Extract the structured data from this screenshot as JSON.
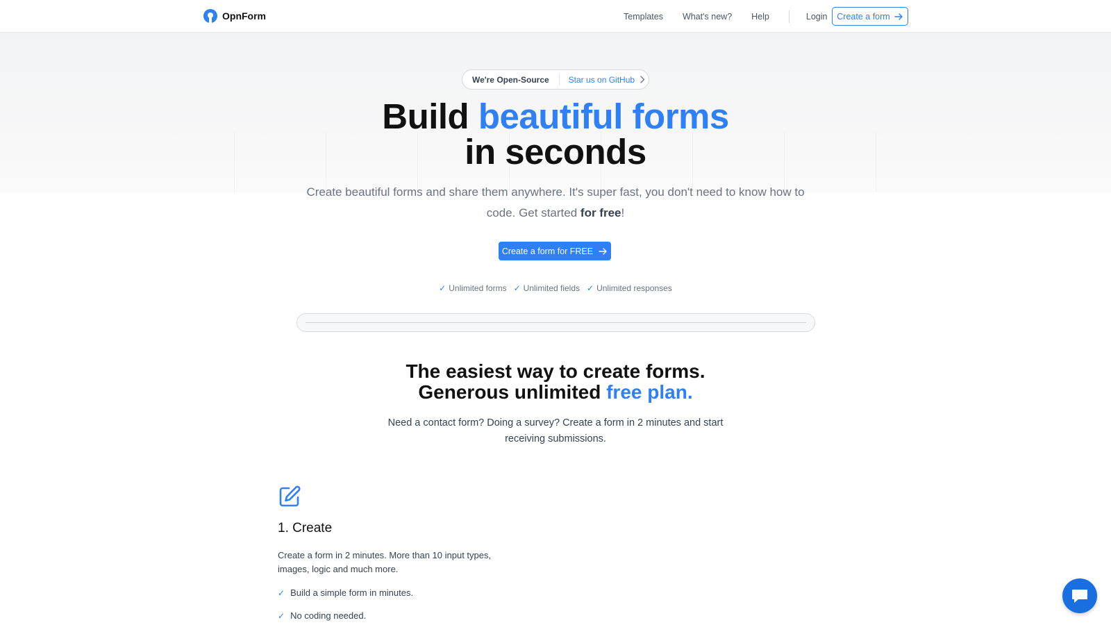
{
  "nav": {
    "brand": "OpnForm",
    "links": [
      "Templates",
      "What's new?",
      "Help"
    ],
    "login": "Login",
    "cta": "Create a form"
  },
  "hero": {
    "pill_left": "We're Open-Source",
    "pill_right": "Star us on GitHub",
    "title_part1": "Build ",
    "title_highlight": "beautiful forms",
    "title_line2": "in seconds",
    "subtitle_part1": "Create beautiful forms and share them anywhere. It's super fast, you don't need to know how to code. Get started ",
    "subtitle_bold": "for free",
    "subtitle_end": "!",
    "cta": "Create a form for FREE",
    "checks": [
      "Unlimited forms",
      "Unlimited fields",
      "Unlimited responses"
    ]
  },
  "section2": {
    "title_line1": "The easiest way to create forms.",
    "title_line2_part1": "Generous unlimited ",
    "title_line2_highlight": "free plan.",
    "description": "Need a contact form? Doing a survey? Create a form in 2 minutes and start receiving submissions."
  },
  "feature": {
    "icon": "edit-icon",
    "title": "1. Create",
    "description": "Create a form in 2 minutes. More than 10 input types, images, logic and much more.",
    "bullets": [
      "Build a simple form in minutes.",
      "No coding needed."
    ]
  },
  "colors": {
    "accent": "#2f7ff5",
    "chat_button": "#1a6fe0"
  }
}
